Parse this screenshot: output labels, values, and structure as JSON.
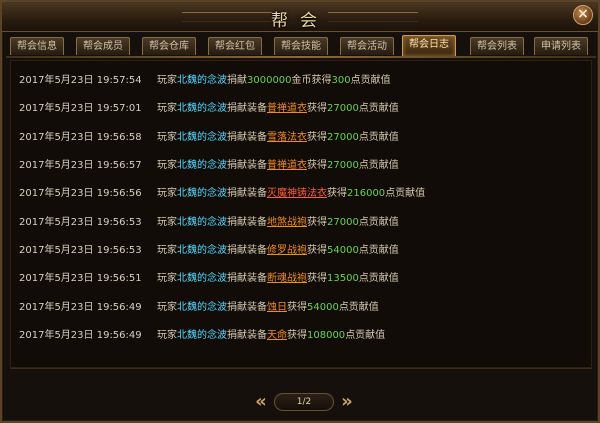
{
  "window": {
    "title": "帮会",
    "close_label": "×"
  },
  "tabs": [
    {
      "label": "帮会信息",
      "active": false
    },
    {
      "label": "帮会成员",
      "active": false
    },
    {
      "label": "帮会仓库",
      "active": false
    },
    {
      "label": "帮会红包",
      "active": false
    },
    {
      "label": "帮会技能",
      "active": false
    },
    {
      "label": "帮会活动",
      "active": false
    },
    {
      "label": "帮会日志",
      "active": true
    },
    {
      "label": "帮会列表",
      "active": false
    },
    {
      "label": "申请列表",
      "active": false
    }
  ],
  "log": [
    {
      "time": "2017年5月23日  19:57:54",
      "prefix": "玩家",
      "player": "北魏的念波",
      "action": "捐献",
      "item": "",
      "amount": "3000000",
      "unit": "金币",
      "gain_label": "获得",
      "points": "300",
      "suffix": "点贡献值"
    },
    {
      "time": "2017年5月23日  19:57:01",
      "prefix": "玩家",
      "player": "北魏的念波",
      "action": "捐献装备",
      "item": "普禅道衣",
      "amount": "",
      "unit": "",
      "gain_label": "获得",
      "points": "27000",
      "suffix": "点贡献值"
    },
    {
      "time": "2017年5月23日  19:56:58",
      "prefix": "玩家",
      "player": "北魏的念波",
      "action": "捐献装备",
      "item": "雪落法衣",
      "amount": "",
      "unit": "",
      "gain_label": "获得",
      "points": "27000",
      "suffix": "点贡献值"
    },
    {
      "time": "2017年5月23日  19:56:57",
      "prefix": "玩家",
      "player": "北魏的念波",
      "action": "捐献装备",
      "item": "普禅道衣",
      "amount": "",
      "unit": "",
      "gain_label": "获得",
      "points": "27000",
      "suffix": "点贡献值"
    },
    {
      "time": "2017年5月23日  19:56:56",
      "prefix": "玩家",
      "player": "北魏的念波",
      "action": "捐献装备",
      "item": "灭魔神铸法衣",
      "amount": "",
      "unit": "",
      "gain_label": "获得",
      "points": "216000",
      "suffix": "点贡献值"
    },
    {
      "time": "2017年5月23日  19:56:53",
      "prefix": "玩家",
      "player": "北魏的念波",
      "action": "捐献装备",
      "item": "地煞战袍",
      "amount": "",
      "unit": "",
      "gain_label": "获得",
      "points": "27000",
      "suffix": "点贡献值"
    },
    {
      "time": "2017年5月23日  19:56:53",
      "prefix": "玩家",
      "player": "北魏的念波",
      "action": "捐献装备",
      "item": "修罗战袍",
      "amount": "",
      "unit": "",
      "gain_label": "获得",
      "points": "54000",
      "suffix": "点贡献值"
    },
    {
      "time": "2017年5月23日  19:56:51",
      "prefix": "玩家",
      "player": "北魏的念波",
      "action": "捐献装备",
      "item": "断魂战袍",
      "amount": "",
      "unit": "",
      "gain_label": "获得",
      "points": "13500",
      "suffix": "点贡献值"
    },
    {
      "time": "2017年5月23日  19:56:49",
      "prefix": "玩家",
      "player": "北魏的念波",
      "action": "捐献装备",
      "item": "蚀日",
      "amount": "",
      "unit": "",
      "gain_label": "获得",
      "points": "54000",
      "suffix": "点贡献值"
    },
    {
      "time": "2017年5月23日  19:56:49",
      "prefix": "玩家",
      "player": "北魏的念波",
      "action": "捐献装备",
      "item": "天命",
      "amount": "",
      "unit": "",
      "gain_label": "获得",
      "points": "108000",
      "suffix": "点贡献值"
    }
  ],
  "pager": {
    "page_text": "1/2",
    "prev_icon": "chevron-left-icon",
    "next_icon": "chevron-right-icon"
  },
  "colors": {
    "player": "#55d8ff",
    "number": "#6ad24f",
    "item": "#f28c1d",
    "tab_active": "#ffe3a8"
  }
}
